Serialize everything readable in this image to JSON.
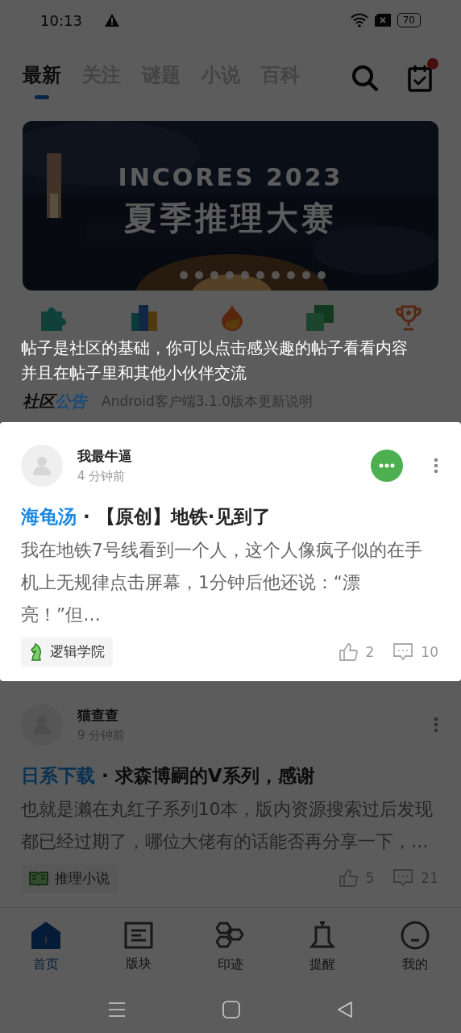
{
  "status_bar": {
    "time": "10:13",
    "battery": "70"
  },
  "tabs": [
    {
      "label": "最新",
      "selected": true
    },
    {
      "label": "关注",
      "selected": false
    },
    {
      "label": "谜题",
      "selected": false
    },
    {
      "label": "小说",
      "selected": false
    },
    {
      "label": "百科",
      "selected": false
    }
  ],
  "calendar_button": {
    "has_notification": true
  },
  "banner": {
    "title": "INCORES 2023",
    "subtitle": "夏季推理大赛"
  },
  "guide": {
    "lines": [
      "帖子是社区的基础，你可以点击感兴趣的帖子看看内容",
      "并且在帖子里和其他小伙伴交流"
    ]
  },
  "announcement": {
    "label_1": "社区",
    "label_2": "公告",
    "text": "Android客户端3.1.0版本更新说明"
  },
  "posts": [
    {
      "highlighted": true,
      "chat_badge": true,
      "author": "我最牛逼",
      "time": "4 分钟前",
      "category": "海龟汤",
      "separator": "·",
      "title": "【原创】地铁·见到了",
      "excerpt": "我在地铁7号线看到一个人，这个人像疯子似的在手机上无规律点击屏幕，1分钟后他还说：“漂亮！”但…",
      "tag": "逻辑学院",
      "likes": "2",
      "comments": "10"
    },
    {
      "highlighted": false,
      "chat_badge": false,
      "author": "猫查查",
      "time": "9 分钟前",
      "category": "日系下载",
      "separator": "·",
      "title": "求森博嗣的V系列，感谢",
      "excerpt": "也就是濑在丸红子系列10本，版内资源搜索过后发现都已经过期了，哪位大佬有的话能否再分享一下，…",
      "tag": "推理小说",
      "likes": "5",
      "comments": "21"
    }
  ],
  "bottom_nav": [
    {
      "label": "首页",
      "selected": true
    },
    {
      "label": "版块",
      "selected": false
    },
    {
      "label": "印迹",
      "selected": false
    },
    {
      "label": "提醒",
      "selected": false
    },
    {
      "label": "我的",
      "selected": false
    }
  ]
}
